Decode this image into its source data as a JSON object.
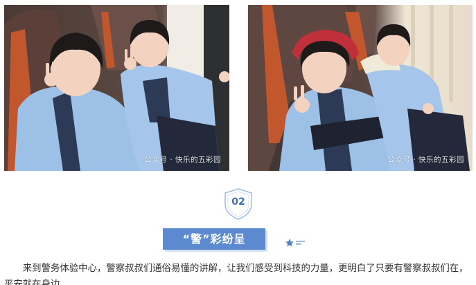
{
  "photos": [
    {
      "watermark": "公众号 · 快乐的五彩园"
    },
    {
      "watermark": "公众号 · 快乐的五彩园"
    }
  ],
  "section": {
    "number": "02",
    "title": "“警”彩纷呈"
  },
  "paragraph": "来到警务体验中心，警察叔叔们通俗易懂的讲解，让我们感受到科技的力量，更明白了只要有警察叔叔们在，平安就在身边。",
  "colors": {
    "accent_blue": "#5b8ad0",
    "number_blue": "#3a6fb6"
  },
  "icons": {
    "badge": "shield-icon",
    "deco": "star-icon"
  }
}
